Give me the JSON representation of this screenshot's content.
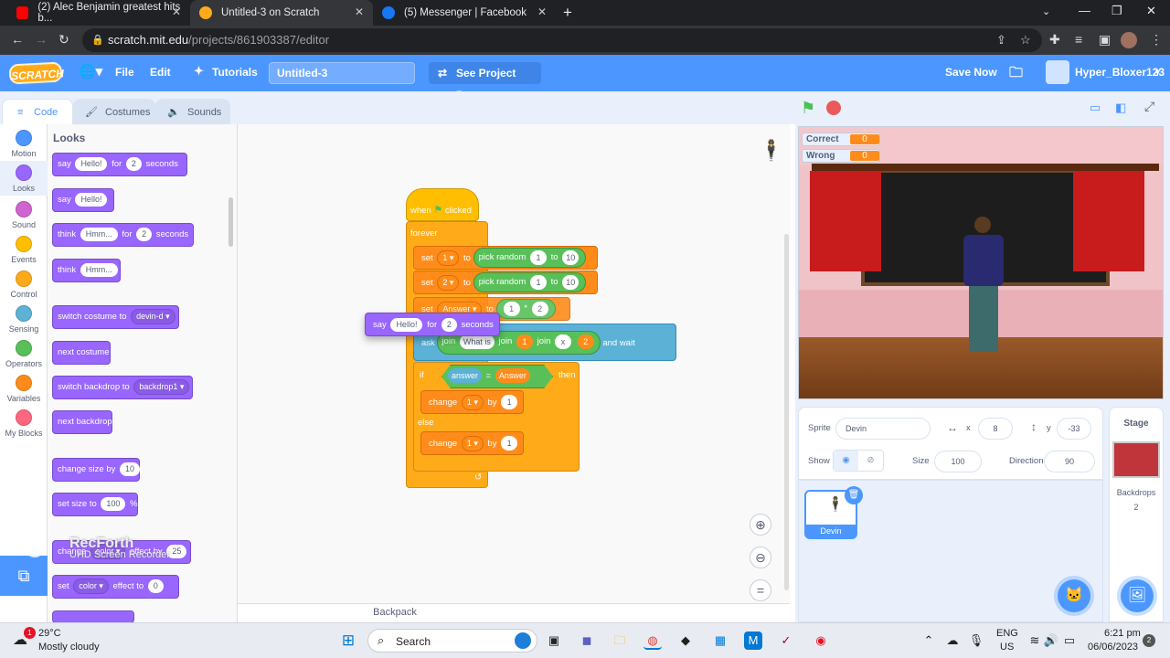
{
  "browser": {
    "tabs": [
      {
        "title": "(2) Alec Benjamin greatest hits b...",
        "favicon": "youtube-icon",
        "color": "#ff0000"
      },
      {
        "title": "Untitled-3 on Scratch",
        "favicon": "scratch-icon",
        "color": "#ffab19"
      },
      {
        "title": "(5) Messenger | Facebook",
        "favicon": "facebook-icon",
        "color": "#1877f2"
      }
    ],
    "url_host": "scratch.mit.edu",
    "url_path": "/projects/861903387/editor"
  },
  "menubar": {
    "logo": "SCRATCH",
    "file": "File",
    "edit": "Edit",
    "tutorials": "Tutorials",
    "title": "Untitled-3",
    "see_project": "See Project Page",
    "save_now": "Save Now",
    "username": "Hyper_Bloxer123"
  },
  "editor_tabs": {
    "code": "Code",
    "costumes": "Costumes",
    "sounds": "Sounds"
  },
  "categories": [
    {
      "label": "Motion",
      "color": "#4c97ff"
    },
    {
      "label": "Looks",
      "color": "#9966ff"
    },
    {
      "label": "Sound",
      "color": "#cf63cf"
    },
    {
      "label": "Events",
      "color": "#ffbf00"
    },
    {
      "label": "Control",
      "color": "#ffab19"
    },
    {
      "label": "Sensing",
      "color": "#5cb1d6"
    },
    {
      "label": "Operators",
      "color": "#59c059"
    },
    {
      "label": "Variables",
      "color": "#ff8c1a"
    },
    {
      "label": "My Blocks",
      "color": "#ff6680"
    }
  ],
  "palette": {
    "title": "Looks",
    "say_for": {
      "a": "say",
      "b": "Hello!",
      "c": "for",
      "d": "2",
      "e": "seconds"
    },
    "say": {
      "a": "say",
      "b": "Hello!"
    },
    "think_for": {
      "a": "think",
      "b": "Hmm...",
      "c": "for",
      "d": "2",
      "e": "seconds"
    },
    "think": {
      "a": "think",
      "b": "Hmm..."
    },
    "switch_costume": {
      "a": "switch costume to",
      "b": "devin-d"
    },
    "next_costume": "next costume",
    "switch_backdrop": {
      "a": "switch backdrop to",
      "b": "backdrop1"
    },
    "next_backdrop": "next backdrop",
    "change_size": {
      "a": "change size by",
      "b": "10"
    },
    "set_size": {
      "a": "set size to",
      "b": "100",
      "c": "%"
    },
    "change_effect": {
      "a": "change",
      "b": "color",
      "c": "effect by",
      "d": "25"
    },
    "set_effect": {
      "a": "set",
      "b": "color",
      "c": "effect to",
      "d": "0"
    }
  },
  "script": {
    "when_flag": {
      "a": "when",
      "b": "clicked"
    },
    "forever": "forever",
    "set1": {
      "a": "set",
      "b": "1",
      "c": "to",
      "d": "pick random",
      "e": "1",
      "f": "to",
      "g": "10"
    },
    "set2": {
      "a": "set",
      "b": "2",
      "c": "to",
      "d": "pick random",
      "e": "1",
      "f": "to",
      "g": "10"
    },
    "set3": {
      "a": "set",
      "b": "Answer",
      "c": "to",
      "d": "1",
      "e": "*",
      "f": "2"
    },
    "ask": {
      "a": "ask",
      "b": "join",
      "c": "What is",
      "d": "join",
      "e": "1",
      "f": "join",
      "g": "x",
      "h": "2",
      "i": "and wait"
    },
    "if": {
      "a": "if",
      "b": "answer",
      "c": "=",
      "d": "Answer",
      "e": "then"
    },
    "change1": {
      "a": "change",
      "b": "1",
      "c": "by",
      "d": "1"
    },
    "else": "else",
    "change2": {
      "a": "change",
      "b": "1",
      "c": "by",
      "d": "1"
    },
    "dragging_say": {
      "a": "say",
      "b": "Hello!",
      "c": "for",
      "d": "2",
      "e": "seconds"
    }
  },
  "workspace": {
    "backpack": "Backpack"
  },
  "watermark": {
    "line1": "RecForth",
    "line2": "UHD Screen Recorder"
  },
  "stage": {
    "monitors": [
      {
        "label": "Correct",
        "value": "0"
      },
      {
        "label": "Wrong",
        "value": "0"
      }
    ]
  },
  "sprite_info": {
    "sprite_label": "Sprite",
    "sprite_name": "Devin",
    "x_label": "x",
    "x": "8",
    "y_label": "y",
    "y": "-33",
    "show_label": "Show",
    "size_label": "Size",
    "size": "100",
    "direction_label": "Direction",
    "direction": "90"
  },
  "sprites": [
    {
      "name": "Devin"
    }
  ],
  "stage_selector": {
    "title": "Stage",
    "backdrops_label": "Backdrops",
    "backdrops_count": "2"
  },
  "taskbar": {
    "temp": "29°C",
    "weather": "Mostly cloudy",
    "search": "Search",
    "lang1": "ENG",
    "lang2": "US",
    "time": "6:21 pm",
    "date": "06/06/2023",
    "notif": "2",
    "weather_badge": "1"
  }
}
